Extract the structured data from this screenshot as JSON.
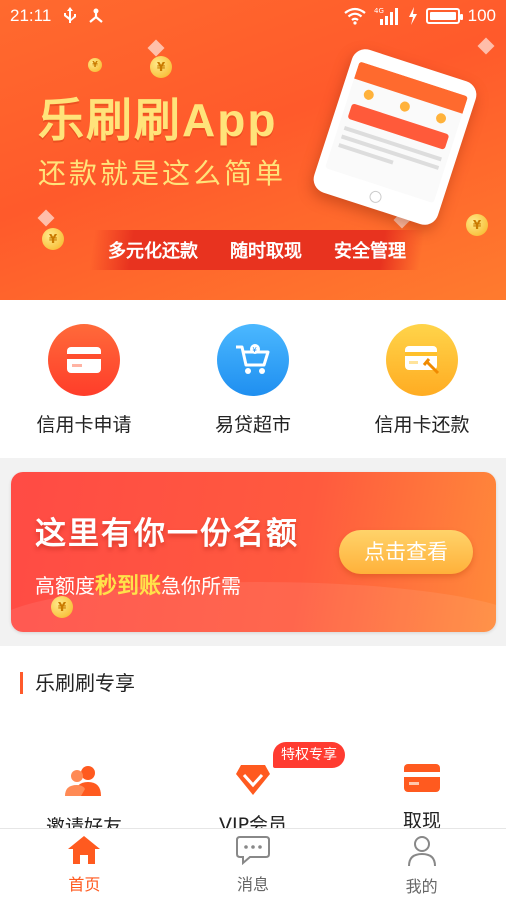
{
  "status_bar": {
    "time": "21:11",
    "battery": "100",
    "signal_label": "4G"
  },
  "banner": {
    "title": "乐刷刷App",
    "subtitle": "还款就是这么简单",
    "features": [
      "多元化还款",
      "随时取现",
      "安全管理"
    ]
  },
  "quick_entries": [
    {
      "label": "信用卡申请",
      "icon": "credit-card-icon",
      "color": "#ff4d2e"
    },
    {
      "label": "易贷超市",
      "icon": "shopping-cart-icon",
      "color": "#2a9df4"
    },
    {
      "label": "信用卡还款",
      "icon": "card-repay-icon",
      "color": "#ffc02a"
    }
  ],
  "promo": {
    "title": "这里有你一份名额",
    "sub_prefix": "高额度",
    "sub_highlight": "秒到账",
    "sub_suffix": "急你所需",
    "button": "点击查看"
  },
  "exclusive": {
    "title": "乐刷刷专享",
    "badge": "特权专享",
    "items": [
      {
        "label": "邀请好友",
        "icon": "users-icon"
      },
      {
        "label": "VIP会员",
        "icon": "diamond-icon"
      },
      {
        "label": "取现",
        "icon": "card-icon"
      }
    ]
  },
  "bottom_nav": [
    {
      "label": "首页",
      "icon": "home-icon",
      "active": true
    },
    {
      "label": "消息",
      "icon": "message-icon",
      "active": false
    },
    {
      "label": "我的",
      "icon": "profile-icon",
      "active": false
    }
  ],
  "colors": {
    "accent": "#ff5a1f",
    "banner": "#ff6a2e",
    "title_yellow": "#ffe37a"
  }
}
